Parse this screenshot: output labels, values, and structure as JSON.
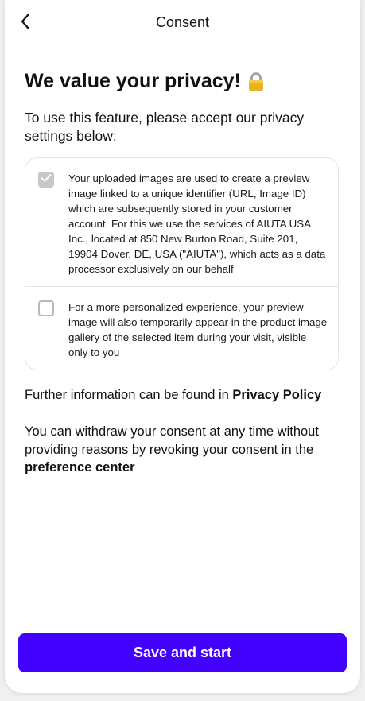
{
  "nav": {
    "title": "Consent",
    "back_icon": "chevron-left-icon"
  },
  "heading": {
    "text": "We value your privacy!",
    "icon": "lock-icon"
  },
  "intro": "To use this feature, please accept our privacy settings below:",
  "consents": [
    {
      "checked": true,
      "disabled": true,
      "text": "Your uploaded images are used to create a preview image linked to a unique identifier (URL, Image ID) which are subsequently stored in your customer account. For this we use the services of AIUTA USA Inc., located at 850 New Burton Road, Suite 201, 19904 Dover, DE, USA (\"AIUTA\"), which acts as a data processor exclusively on our behalf"
    },
    {
      "checked": false,
      "disabled": false,
      "text": "For a more personalized experience, your preview image will also temporarily appear in the product image gallery of the selected item during your visit, visible only to you"
    }
  ],
  "further_info": {
    "prefix": "Further information can be found in ",
    "link": "Privacy Policy"
  },
  "withdraw": {
    "prefix": "You can withdraw your consent at any time without providing reasons by revoking your consent in the ",
    "link": "preference center"
  },
  "cta": {
    "label": "Save and start"
  },
  "colors": {
    "accent": "#4200ff",
    "checkbox_disabled": "#c7c7cc",
    "border": "#e4e4e8"
  }
}
